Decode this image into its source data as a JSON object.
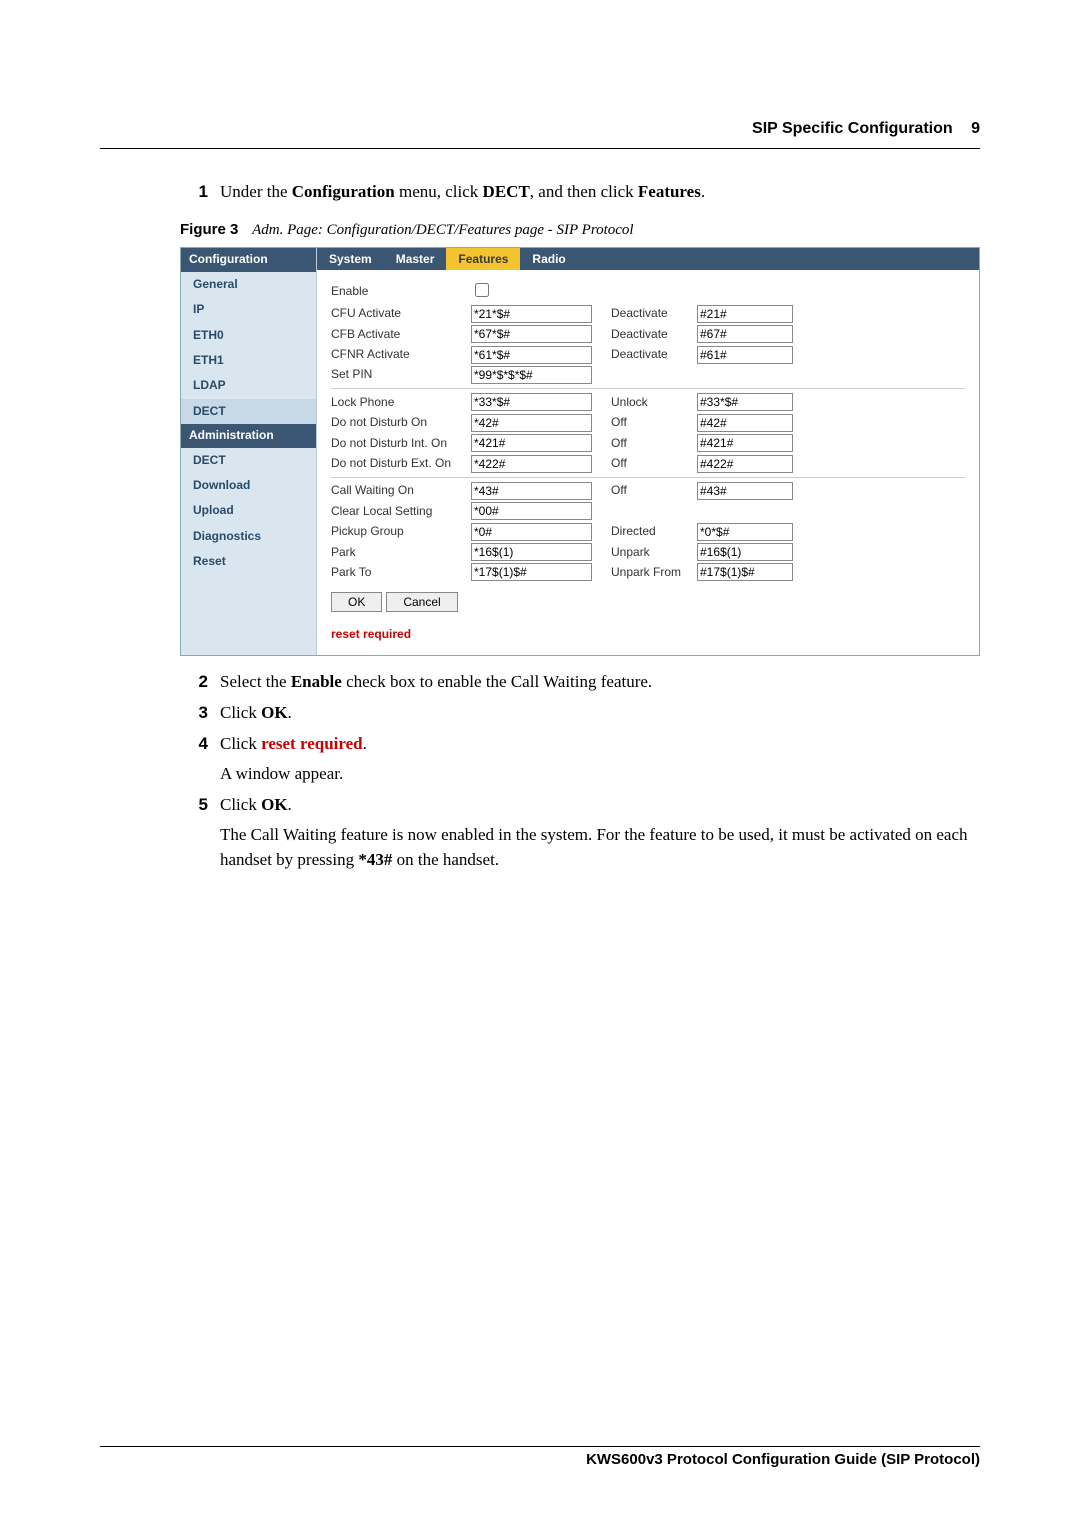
{
  "header": {
    "section": "SIP Specific Configuration",
    "page_number": "9"
  },
  "steps": {
    "s1": {
      "num": "1",
      "pre": "Under the ",
      "b1": "Configuration",
      "mid1": " menu, click ",
      "b2": "DECT",
      "mid2": ", and then click ",
      "b3": "Features",
      "post": "."
    },
    "s2": {
      "num": "2",
      "pre": "Select the ",
      "b1": "Enable",
      "post": " check box to enable the Call Waiting feature."
    },
    "s3": {
      "num": "3",
      "pre": "Click ",
      "b1": "OK",
      "post": "."
    },
    "s4": {
      "num": "4",
      "pre": "Click ",
      "reset": "reset required",
      "post": ".",
      "para": "A window appear."
    },
    "s5": {
      "num": "5",
      "pre": "Click ",
      "b1": "OK",
      "post": ".",
      "para_pre": "The Call Waiting feature is now enabled in the system. For the feature to be used, it must be activated on each handset by pressing ",
      "para_b": "*43#",
      "para_post": " on the handset."
    }
  },
  "figure": {
    "label": "Figure 3",
    "caption": "Adm. Page: Configuration/DECT/Features page - SIP Protocol"
  },
  "adminui": {
    "sidebar": {
      "cat1": "Configuration",
      "items1": [
        "General",
        "IP",
        "ETH0",
        "ETH1",
        "LDAP",
        "DECT"
      ],
      "cat2": "Administration",
      "items2": [
        "DECT",
        "Download",
        "Upload",
        "Diagnostics",
        "Reset"
      ]
    },
    "tabs": [
      "System",
      "Master",
      "Features",
      "Radio"
    ],
    "rows": [
      {
        "l1": "Enable",
        "type": "check"
      },
      {
        "l1": "CFU Activate",
        "v1": "*21*$#",
        "l2": "Deactivate",
        "v2": "#21#"
      },
      {
        "l1": "CFB Activate",
        "v1": "*67*$#",
        "l2": "Deactivate",
        "v2": "#67#"
      },
      {
        "l1": "CFNR Activate",
        "v1": "*61*$#",
        "l2": "Deactivate",
        "v2": "#61#"
      },
      {
        "l1": "Set PIN",
        "v1": "*99*$*$*$#"
      },
      {
        "hr": true,
        "l1": "Lock Phone",
        "v1": "*33*$#",
        "l2": "Unlock",
        "v2": "#33*$#"
      },
      {
        "l1": "Do not Disturb On",
        "v1": "*42#",
        "l2": "Off",
        "v2": "#42#"
      },
      {
        "l1": "Do not Disturb Int. On",
        "v1": "*421#",
        "l2": "Off",
        "v2": "#421#"
      },
      {
        "l1": "Do not Disturb Ext. On",
        "v1": "*422#",
        "l2": "Off",
        "v2": "#422#"
      },
      {
        "hr": true,
        "l1": "Call Waiting On",
        "v1": "*43#",
        "l2": "Off",
        "v2": "#43#"
      },
      {
        "l1": "Clear Local Setting",
        "v1": "*00#"
      },
      {
        "l1": "Pickup Group",
        "v1": "*0#",
        "l2": "Directed",
        "v2": "*0*$#"
      },
      {
        "l1": "Park",
        "v1": "*16$(1)",
        "l2": "Unpark",
        "v2": "#16$(1)"
      },
      {
        "l1": "Park To",
        "v1": "*17$(1)$#",
        "l2": "Unpark From",
        "v2": "#17$(1)$#"
      }
    ],
    "buttons": {
      "ok": "OK",
      "cancel": "Cancel"
    },
    "reset_required": "reset required"
  },
  "footer": "KWS600v3 Protocol Configuration Guide (SIP Protocol)"
}
